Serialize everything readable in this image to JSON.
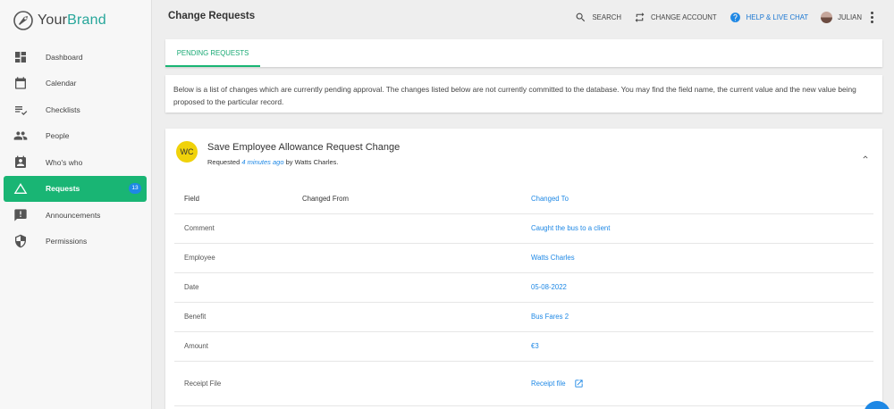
{
  "brand": {
    "part1": "Your",
    "part2": "Brand"
  },
  "sidebar": {
    "items": [
      {
        "label": "Dashboard"
      },
      {
        "label": "Calendar"
      },
      {
        "label": "Checklists"
      },
      {
        "label": "People"
      },
      {
        "label": "Who's who"
      },
      {
        "label": "Requests",
        "badge": "13"
      },
      {
        "label": "Announcements"
      },
      {
        "label": "Permissions"
      }
    ]
  },
  "header": {
    "title": "Change Requests",
    "search": "SEARCH",
    "change_account": "CHANGE ACCOUNT",
    "help": "HELP & LIVE CHAT",
    "user": "JULIAN"
  },
  "tabs": [
    {
      "label": "PENDING REQUESTS"
    }
  ],
  "info": "Below is a list of changes which are currently pending approval. The changes listed below are not currently committed to the database. You may find the field name, the current value and the new value being proposed to the particular record.",
  "request": {
    "initials": "WC",
    "title": "Save Employee Allowance Request Change",
    "requested_prefix": "Requested",
    "time": "4 minutes ago",
    "by": "by Watts Charles.",
    "columns": {
      "field": "Field",
      "from": "Changed From",
      "to": "Changed To"
    },
    "rows": [
      {
        "field": "Comment",
        "from": "",
        "to": "Caught the bus to a client"
      },
      {
        "field": "Employee",
        "from": "",
        "to": "Watts Charles"
      },
      {
        "field": "Date",
        "from": "",
        "to": "05-08-2022"
      },
      {
        "field": "Benefit",
        "from": "",
        "to": "Bus Fares 2"
      },
      {
        "field": "Amount",
        "from": "",
        "to": "€3"
      },
      {
        "field": "Receipt File",
        "from": "",
        "to": "Receipt file"
      }
    ]
  },
  "colors": {
    "accent": "#19b574",
    "link": "#1e88e5",
    "avatar": "#f0d20a"
  }
}
